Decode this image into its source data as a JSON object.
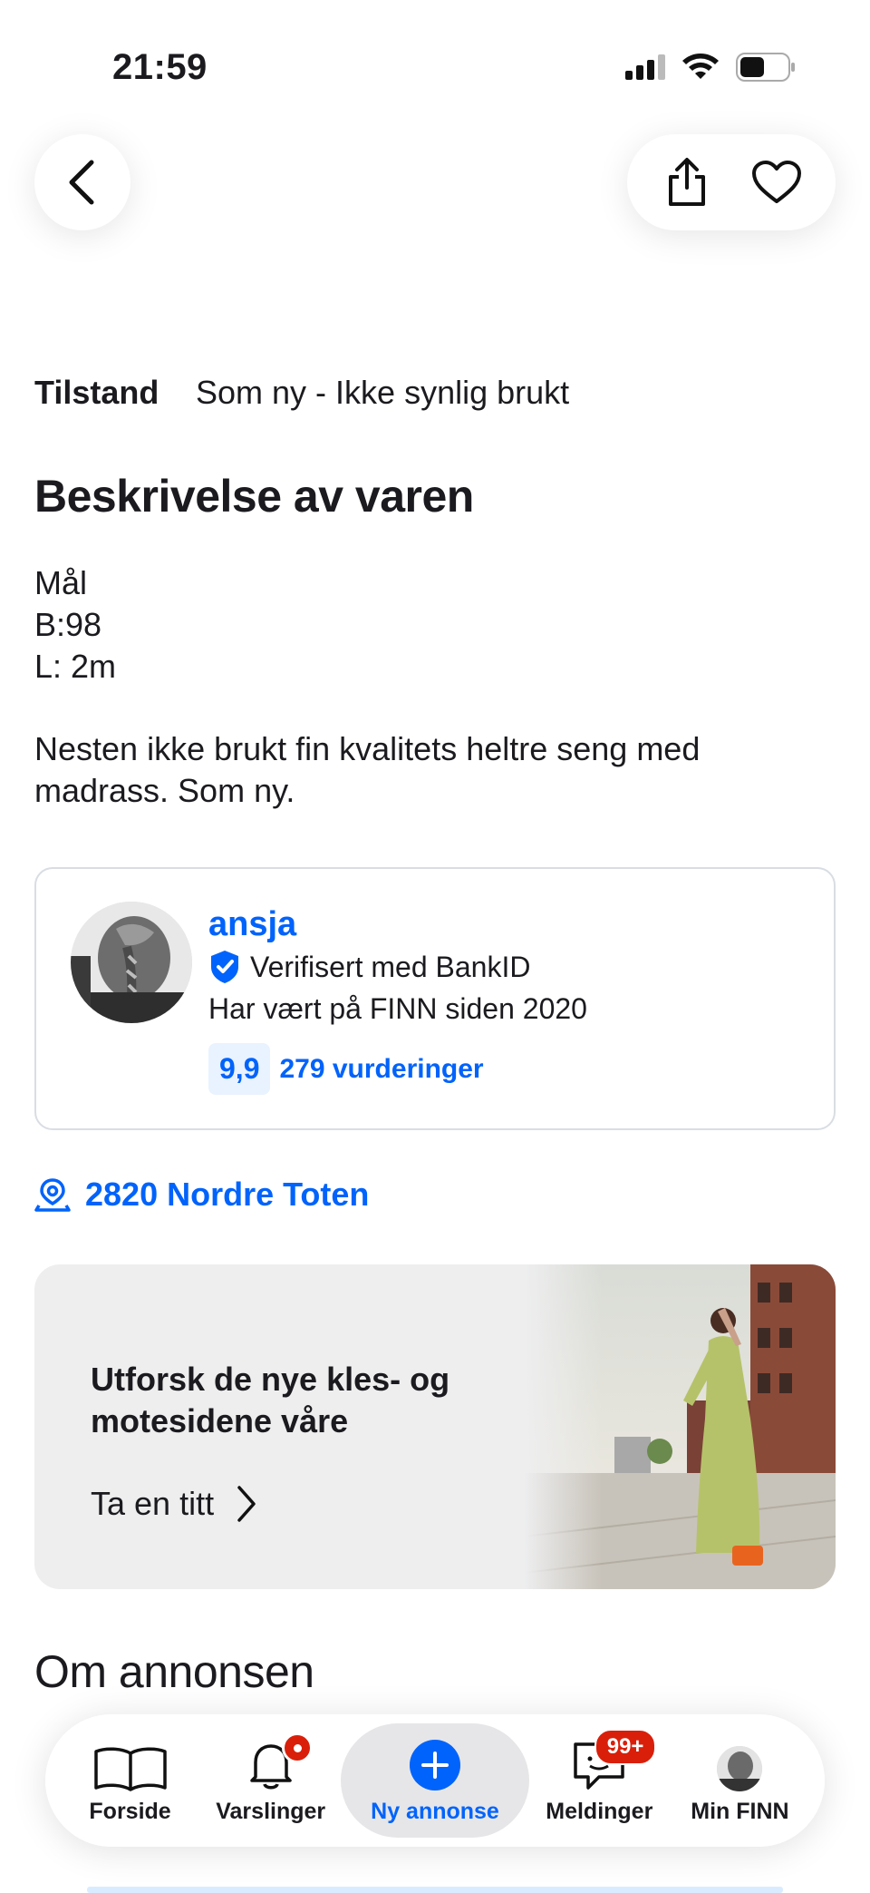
{
  "status_bar": {
    "time": "21:59",
    "icons": [
      "cellular-signal-icon",
      "wifi-icon",
      "battery-icon"
    ]
  },
  "header": {
    "back_icon": "chevron-left-icon",
    "share_icon": "share-icon",
    "favorite_icon": "heart-icon"
  },
  "condition": {
    "label": "Tilstand",
    "value": "Som ny - Ikke synlig brukt"
  },
  "description": {
    "title": "Beskrivelse av varen",
    "lines": [
      "Mål",
      "B:98",
      "L: 2m"
    ],
    "text": "Nesten ikke brukt fin kvalitets heltre seng med madrass. Som ny."
  },
  "seller": {
    "name": "ansja",
    "verified": "Verifisert med BankID",
    "member_since": "Har vært på FINN siden 2020",
    "rating": "9,9",
    "reviews": "279 vurderinger"
  },
  "location": {
    "icon": "location-pin-icon",
    "text": "2820 Nordre Toten"
  },
  "promo": {
    "title": "Utforsk de nye kles- og motesidene våre",
    "link": "Ta en titt"
  },
  "about": {
    "title": "Om annonsen"
  },
  "bottom_nav": {
    "items": [
      {
        "label": "Forside",
        "icon": "book-icon"
      },
      {
        "label": "Varslinger",
        "icon": "bell-icon"
      },
      {
        "label": "Ny annonse",
        "icon": "plus-circle-icon"
      },
      {
        "label": "Meldinger",
        "icon": "chat-icon",
        "badge": "99+"
      },
      {
        "label": "Min FINN",
        "icon": "profile-avatar"
      }
    ]
  },
  "colors": {
    "accent": "#0063fb",
    "badge": "#d91f0a",
    "text": "#1b1b1f"
  }
}
